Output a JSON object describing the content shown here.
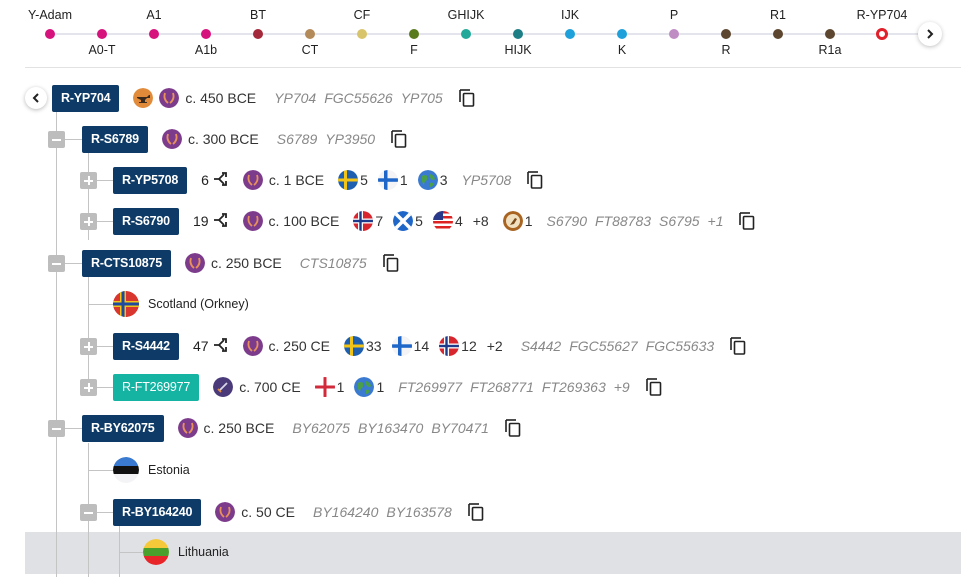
{
  "timeline": {
    "nodes": [
      {
        "label": "Y-Adam",
        "color": "#d6137d",
        "pos": "up"
      },
      {
        "label": "A0-T",
        "color": "#d6137d",
        "pos": "down"
      },
      {
        "label": "A1",
        "color": "#d6137d",
        "pos": "up"
      },
      {
        "label": "A1b",
        "color": "#d6137d",
        "pos": "down"
      },
      {
        "label": "BT",
        "color": "#a3283a",
        "pos": "up"
      },
      {
        "label": "CT",
        "color": "#b38a5a",
        "pos": "down"
      },
      {
        "label": "CF",
        "color": "#d8c46a",
        "pos": "up"
      },
      {
        "label": "F",
        "color": "#5a7a1e",
        "pos": "down"
      },
      {
        "label": "GHIJK",
        "color": "#22a898",
        "pos": "up"
      },
      {
        "label": "HIJK",
        "color": "#1e7e86",
        "pos": "down"
      },
      {
        "label": "IJK",
        "color": "#1ea0da",
        "pos": "up"
      },
      {
        "label": "K",
        "color": "#1ea0da",
        "pos": "down"
      },
      {
        "label": "P",
        "color": "#c08cc4",
        "pos": "up"
      },
      {
        "label": "R",
        "color": "#5c4630",
        "pos": "down"
      },
      {
        "label": "R1",
        "color": "#5c4630",
        "pos": "up"
      },
      {
        "label": "R1a",
        "color": "#5c4630",
        "pos": "down"
      },
      {
        "label": "R-YP704",
        "color": "#e0202a",
        "pos": "up",
        "current": true
      }
    ],
    "next_button": "chevron-right"
  },
  "tree": {
    "root": {
      "name": "R-YP704",
      "icons": [
        "anvil-icon",
        "laurel-icon"
      ],
      "age": "c. 450 BCE",
      "snps": [
        "YP704",
        "FGC55626",
        "YP705"
      ]
    },
    "nodes": [
      {
        "id": "s6789",
        "name": "R-S6789",
        "toggle": "minus",
        "icons": [
          "laurel-icon"
        ],
        "age": "c. 300 BCE",
        "snps": [
          "S6789",
          "YP3950"
        ]
      },
      {
        "id": "yp5708",
        "name": "R-YP5708",
        "toggle": "plus",
        "subclades": "6",
        "icons": [
          "laurel-icon"
        ],
        "age": "c. 1 BCE",
        "flags": [
          {
            "icon": "sweden-flag",
            "count": "5"
          },
          {
            "icon": "finland-flag",
            "count": "1"
          },
          {
            "icon": "globe-icon",
            "count": "3"
          }
        ],
        "snps": [
          "YP5708"
        ]
      },
      {
        "id": "s6790",
        "name": "R-S6790",
        "toggle": "plus",
        "subclades": "19",
        "icons": [
          "laurel-icon"
        ],
        "age": "c. 100 BCE",
        "flags": [
          {
            "icon": "norway-flag",
            "count": "7"
          },
          {
            "icon": "scotland-flag",
            "count": "5"
          },
          {
            "icon": "usa-flag",
            "count": "4"
          }
        ],
        "more_flags": "+8",
        "ancient": {
          "icon": "trowel-icon",
          "count": "1"
        },
        "snps": [
          "S6790",
          "FT88783",
          "S6795",
          "+1"
        ]
      },
      {
        "id": "cts10875",
        "name": "R-CTS10875",
        "toggle": "minus",
        "icons": [
          "laurel-icon"
        ],
        "age": "c. 250 BCE",
        "snps": [
          "CTS10875"
        ]
      },
      {
        "id": "s4442",
        "name": "R-S4442",
        "toggle": "plus",
        "subclades": "47",
        "icons": [
          "laurel-icon"
        ],
        "age": "c. 250 CE",
        "flags": [
          {
            "icon": "sweden-flag",
            "count": "33"
          },
          {
            "icon": "finland-flag",
            "count": "14"
          },
          {
            "icon": "norway-flag",
            "count": "12"
          }
        ],
        "more_flags": "+2",
        "snps": [
          "S4442",
          "FGC55627",
          "FGC55633"
        ]
      },
      {
        "id": "ft269977",
        "name": "R-FT269977",
        "toggle": "plus",
        "icons": [
          "sword-icon"
        ],
        "age": "c. 700 CE",
        "flags": [
          {
            "icon": "england-flag",
            "count": "1"
          },
          {
            "icon": "globe-icon",
            "count": "1"
          }
        ],
        "snps": [
          "FT269977",
          "FT268771",
          "FT269363",
          "+9"
        ]
      },
      {
        "id": "by62075",
        "name": "R-BY62075",
        "toggle": "minus",
        "icons": [
          "laurel-icon"
        ],
        "age": "c. 250 BCE",
        "snps": [
          "BY62075",
          "BY163470",
          "BY70471"
        ]
      },
      {
        "id": "by164240",
        "name": "R-BY164240",
        "toggle": "minus",
        "icons": [
          "laurel-icon"
        ],
        "age": "c. 50 CE",
        "snps": [
          "BY164240",
          "BY163578"
        ]
      }
    ],
    "leaves": [
      {
        "label": "Scotland (Orkney)",
        "icon": "orkney-flag"
      },
      {
        "label": "Estonia",
        "icon": "estonia-flag"
      },
      {
        "label": "Lithuania",
        "icon": "lithuania-flag"
      }
    ]
  }
}
